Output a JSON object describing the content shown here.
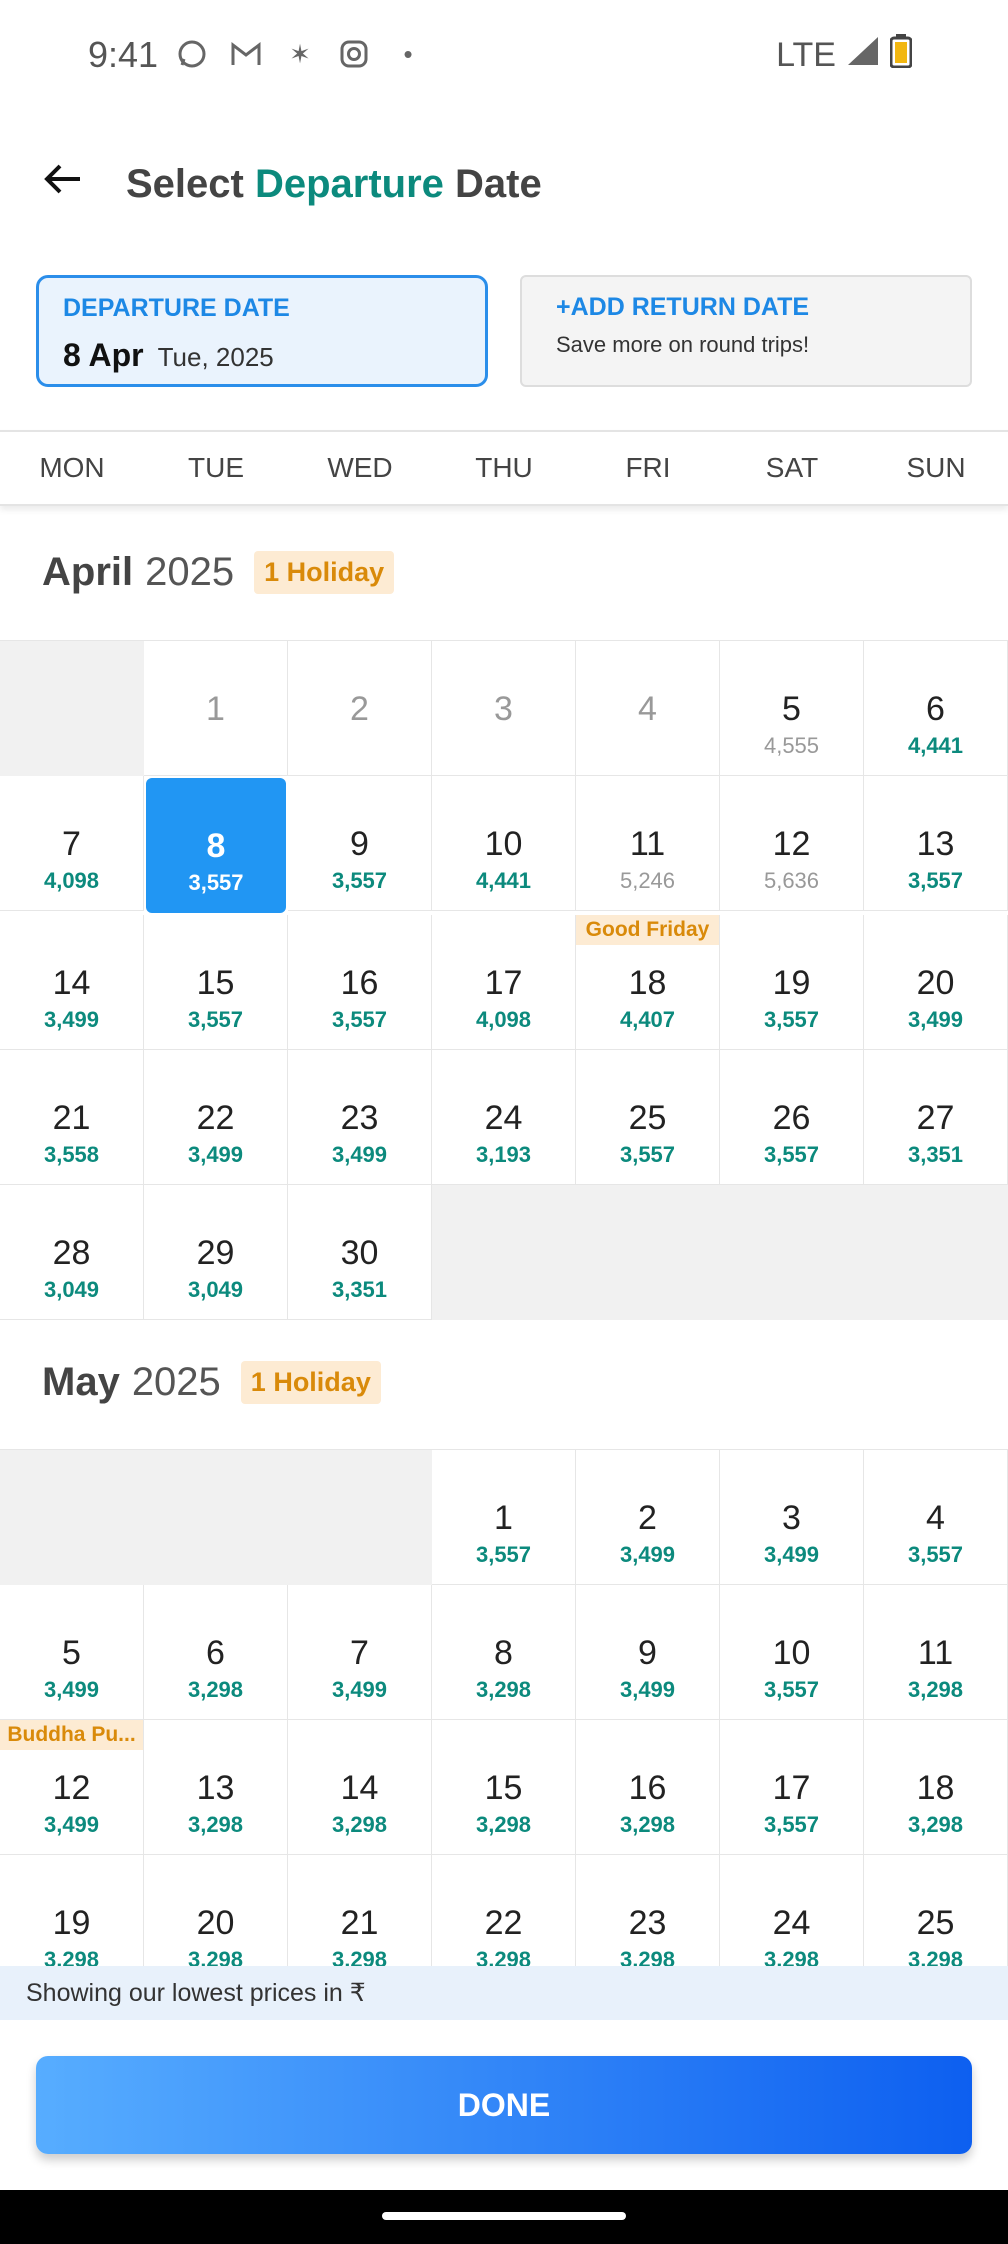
{
  "status_bar": {
    "time": "9:41",
    "network": "LTE"
  },
  "header": {
    "title_prefix": "Select ",
    "title_accent": "Departure",
    "title_suffix": " Date"
  },
  "departure": {
    "label": "DEPARTURE DATE",
    "date": "8 Apr",
    "sub": "Tue, 2025"
  },
  "return": {
    "label": "+ADD RETURN DATE",
    "sub": "Save more on round trips!"
  },
  "weekdays": [
    "MON",
    "TUE",
    "WED",
    "THU",
    "FRI",
    "SAT",
    "SUN"
  ],
  "months": [
    {
      "name": "April",
      "year": "2025",
      "holiday_badge": "1 Holiday",
      "lead_empty": 1,
      "days": [
        {
          "d": "1",
          "past": true
        },
        {
          "d": "2",
          "past": true
        },
        {
          "d": "3",
          "past": true
        },
        {
          "d": "4",
          "past": true
        },
        {
          "d": "5",
          "p": "4,555",
          "grey": true
        },
        {
          "d": "6",
          "p": "4,441"
        },
        {
          "d": "7",
          "p": "4,098"
        },
        {
          "d": "8",
          "p": "3,557",
          "selected": true
        },
        {
          "d": "9",
          "p": "3,557"
        },
        {
          "d": "10",
          "p": "4,441"
        },
        {
          "d": "11",
          "p": "5,246",
          "grey": true
        },
        {
          "d": "12",
          "p": "5,636",
          "grey": true
        },
        {
          "d": "13",
          "p": "3,557"
        },
        {
          "d": "14",
          "p": "3,499"
        },
        {
          "d": "15",
          "p": "3,557"
        },
        {
          "d": "16",
          "p": "3,557"
        },
        {
          "d": "17",
          "p": "4,098"
        },
        {
          "d": "18",
          "p": "4,407",
          "holiday": "Good Friday"
        },
        {
          "d": "19",
          "p": "3,557"
        },
        {
          "d": "20",
          "p": "3,499"
        },
        {
          "d": "21",
          "p": "3,558"
        },
        {
          "d": "22",
          "p": "3,499"
        },
        {
          "d": "23",
          "p": "3,499"
        },
        {
          "d": "24",
          "p": "3,193"
        },
        {
          "d": "25",
          "p": "3,557"
        },
        {
          "d": "26",
          "p": "3,557"
        },
        {
          "d": "27",
          "p": "3,351"
        },
        {
          "d": "28",
          "p": "3,049"
        },
        {
          "d": "29",
          "p": "3,049"
        },
        {
          "d": "30",
          "p": "3,351"
        }
      ],
      "trail_empty": 4
    },
    {
      "name": "May",
      "year": "2025",
      "holiday_badge": "1 Holiday",
      "lead_empty": 3,
      "days": [
        {
          "d": "1",
          "p": "3,557"
        },
        {
          "d": "2",
          "p": "3,499"
        },
        {
          "d": "3",
          "p": "3,499"
        },
        {
          "d": "4",
          "p": "3,557"
        },
        {
          "d": "5",
          "p": "3,499"
        },
        {
          "d": "6",
          "p": "3,298"
        },
        {
          "d": "7",
          "p": "3,499"
        },
        {
          "d": "8",
          "p": "3,298"
        },
        {
          "d": "9",
          "p": "3,499"
        },
        {
          "d": "10",
          "p": "3,557"
        },
        {
          "d": "11",
          "p": "3,298"
        },
        {
          "d": "12",
          "p": "3,499",
          "holiday": "Buddha Pu..."
        },
        {
          "d": "13",
          "p": "3,298"
        },
        {
          "d": "14",
          "p": "3,298"
        },
        {
          "d": "15",
          "p": "3,298"
        },
        {
          "d": "16",
          "p": "3,298"
        },
        {
          "d": "17",
          "p": "3,557"
        },
        {
          "d": "18",
          "p": "3,298"
        },
        {
          "d": "19",
          "p": "3,298"
        },
        {
          "d": "20",
          "p": "3,298"
        },
        {
          "d": "21",
          "p": "3,298"
        },
        {
          "d": "22",
          "p": "3,298"
        },
        {
          "d": "23",
          "p": "3,298"
        },
        {
          "d": "24",
          "p": "3,298"
        },
        {
          "d": "25",
          "p": "3,298"
        }
      ],
      "trail_empty": 0
    }
  ],
  "info_bar": "Showing our lowest prices in ₹",
  "done_label": "DONE"
}
